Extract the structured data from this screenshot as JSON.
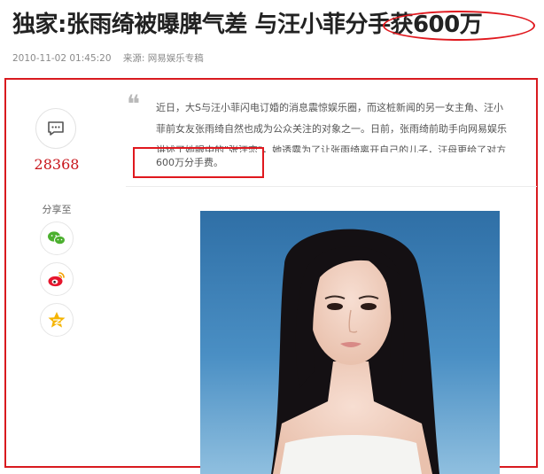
{
  "article": {
    "title_prefix": "独家:张雨绮被曝脾气差 与汪小菲",
    "title_highlight": "分手获600万",
    "datetime": "2010-11-02 01:45:20",
    "source": "来源: 网易娱乐专稿",
    "paragraph_lines": [
      "近日，大S与汪小菲闪电订婚的消息震惊娱乐圈，而这桩新闻的另一女主角、汪小",
      "菲前女友张雨绮自然也成为公众关注的对象之一。日前，张雨绮前助手向网易娱乐",
      "讲述了她眼中的\"张汪恋\"，她透露为了让张雨绮离开自己的儿子，汪母更给了对方",
      "600万分手费。"
    ]
  },
  "sidebar": {
    "comment_icon": "comment-bubble-icon",
    "comment_count": "28368",
    "share_label": "分享至",
    "share_buttons": [
      {
        "icon": "wechat-icon",
        "color": "#4cb02f"
      },
      {
        "icon": "weibo-icon",
        "color": "#e6162d"
      },
      {
        "icon": "qzone-star-icon",
        "color": "#f5b400"
      }
    ]
  },
  "colors": {
    "annotation_red": "#e0181e",
    "count_red": "#c8141a",
    "photo_background": "#3f86bd"
  },
  "media": {
    "photo_subject": "portrait-photo"
  }
}
